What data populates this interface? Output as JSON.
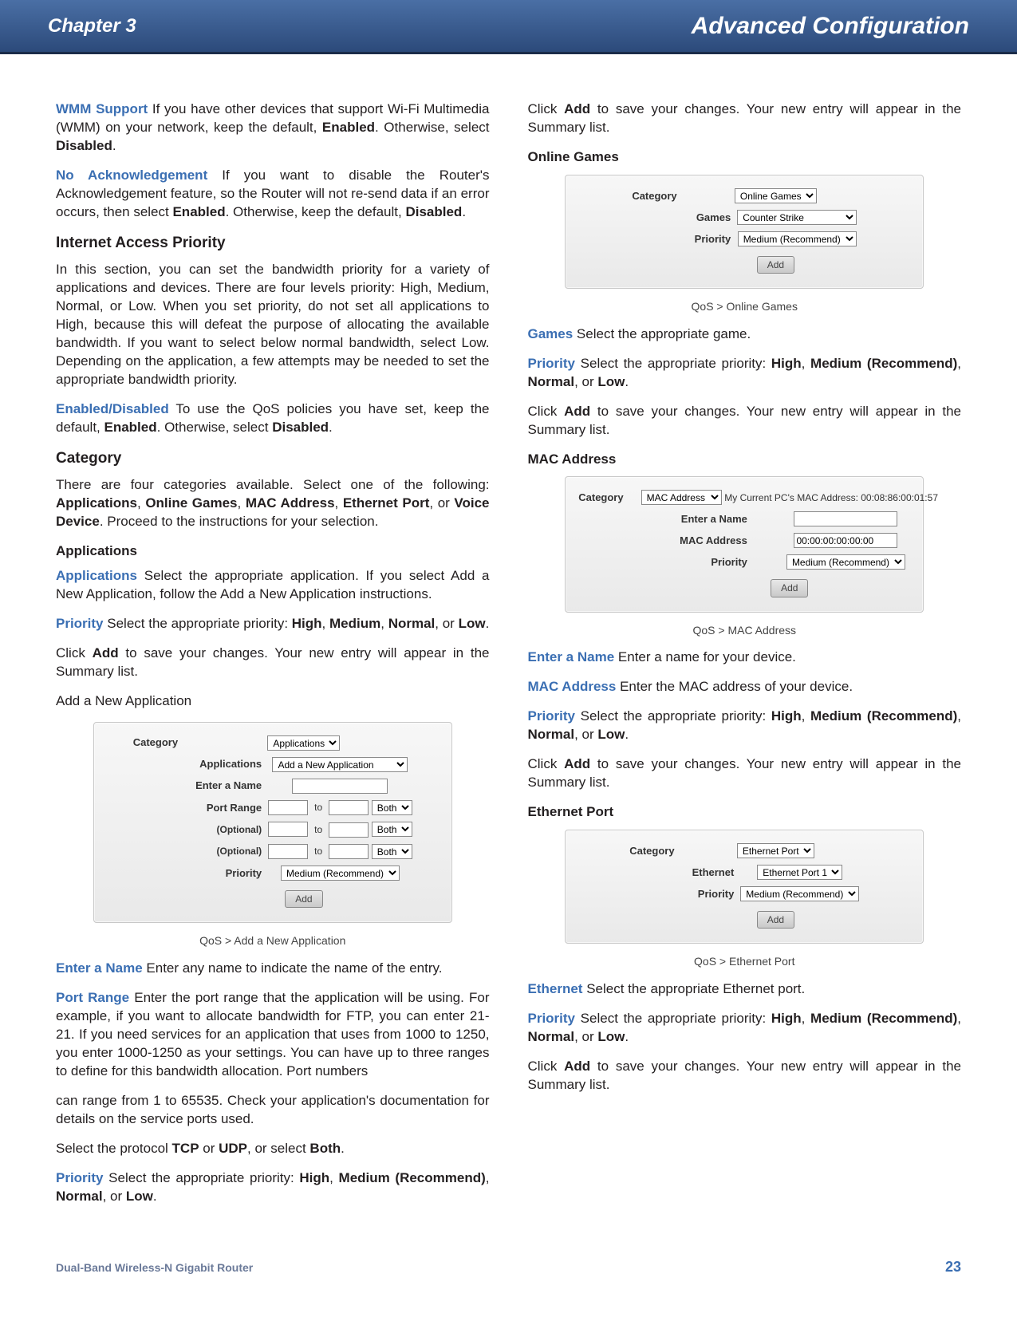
{
  "header": {
    "chapter": "Chapter 3",
    "title": "Advanced Configuration"
  },
  "wmm": {
    "term": "WMM Support",
    "body1": "  If you have other devices that support Wi-Fi Multimedia (WMM) on your network, keep the default, ",
    "enabled": "Enabled",
    "body2": ". Otherwise, select ",
    "disabled": "Disabled",
    "body3": "."
  },
  "noack": {
    "term": "No Acknowledgement",
    "body1": "  If you want to disable the Router's Acknowledgement feature, so the Router will not re-send data if an error occurs, then select ",
    "enabled": "Enabled",
    "body2": ". Otherwise, keep the default, ",
    "disabled": "Disabled",
    "body3": "."
  },
  "iap": {
    "heading": "Internet Access Priority",
    "body": "In this section, you can set the bandwidth priority for a variety of applications and devices. There are four levels priority: High, Medium, Normal, or Low. When you set priority, do not set all applications to High, because this will defeat the purpose of allocating the available bandwidth. If you want to select below normal bandwidth, select Low. Depending on the application, a few attempts may be needed to set the appropriate bandwidth priority."
  },
  "enableddisabled": {
    "term": "Enabled/Disabled",
    "body1": "  To use the QoS policies you have set, keep the default, ",
    "enabled": "Enabled",
    "body2": ". Otherwise, select ",
    "disabled": "Disabled",
    "body3": "."
  },
  "category": {
    "heading": "Category",
    "body1": "There are four categories available. Select one of the following: ",
    "applications": "Applications",
    "sep1": ", ",
    "online": "Online Games",
    "sep2": ", ",
    "mac": "MAC Address",
    "sep3": ", ",
    "eth": "Ethernet Port",
    "sep4": ", or ",
    "voice": "Voice Device",
    "body2": ". Proceed to the instructions for your selection."
  },
  "apps": {
    "heading": "Applications",
    "term": "Applications",
    "body": "  Select the appropriate application. If you select Add a New Application, follow the Add a New Application instructions."
  },
  "priority": {
    "term": "Priority",
    "body1": "  Select the appropriate priority: ",
    "high": "High",
    "sep": ", ",
    "medium": "Medium",
    "sep2": ", ",
    "normal": "Normal",
    "sep3": ", or ",
    "low": "Low",
    "body2": "."
  },
  "priorityRec": {
    "term": "Priority",
    "body1": "  Select the appropriate priority: ",
    "high": "High",
    "sep": ", ",
    "medium": "Medium (Recommend)",
    "sep2": ", ",
    "normal": "Normal",
    "sep3": ", or ",
    "low": "Low",
    "body2": "."
  },
  "clickAdd": {
    "body1": "Click ",
    "add": "Add",
    "body2": " to save your changes. Your new entry will appear in the Summary list."
  },
  "addNewApp": {
    "text": "Add a New Application"
  },
  "fig1": {
    "categoryLbl": "Category",
    "catOpt": "Applications",
    "appsLbl": "Applications",
    "appOpt": "Add a New Application",
    "nameLbl": "Enter a Name",
    "portLbl": "Port Range",
    "optional": "(Optional)",
    "to": "to",
    "both": "Both",
    "prioLbl": "Priority",
    "prioOpt": "Medium (Recommend)",
    "add": "Add",
    "caption": "QoS > Add a New Application"
  },
  "enterName": {
    "term": "Enter a Name",
    "body": "  Enter any name to indicate the name of the entry."
  },
  "portRange": {
    "term": "Port Range",
    "body": "  Enter the port range that the application will be using. For example, if you want to allocate bandwidth for FTP, you can enter 21-21. If you need services for an application that uses from 1000 to 1250, you enter 1000-1250 as your settings. You can have up to three ranges to define for this bandwidth allocation. Port numbers"
  },
  "portRange2": {
    "body": "can range from 1 to 65535. Check your application's documentation for details on the service ports used."
  },
  "protocol": {
    "body1": "Select the protocol ",
    "tcp": "TCP",
    "or1": " or ",
    "udp": "UDP",
    "or2": ", or select ",
    "both": "Both",
    "body2": "."
  },
  "onlineGames": {
    "heading": "Online Games"
  },
  "fig2": {
    "categoryLbl": "Category",
    "catOpt": "Online Games",
    "gamesLbl": "Games",
    "gameOpt": "Counter Strike",
    "prioLbl": "Priority",
    "prioOpt": "Medium (Recommend)",
    "add": "Add",
    "caption": "QoS > Online Games"
  },
  "gamesTerm": {
    "term": "Games",
    "body": "  Select the appropriate game."
  },
  "macAddress": {
    "heading": "MAC Address"
  },
  "fig3": {
    "categoryLbl": "Category",
    "catOpt": "MAC Address",
    "macNote": "My Current PC's MAC Address: 00:08:86:00:01:57",
    "nameLbl": "Enter a Name",
    "macLbl": "MAC Address",
    "macVal": "00:00:00:00:00:00",
    "prioLbl": "Priority",
    "prioOpt": "Medium (Recommend)",
    "add": "Add",
    "caption": "QoS > MAC Address"
  },
  "enterName2": {
    "term": "Enter a Name",
    "body": "  Enter a name for your device."
  },
  "macTerm": {
    "term": "MAC Address",
    "body": "  Enter the MAC address of your device."
  },
  "ethPort": {
    "heading": "Ethernet Port"
  },
  "fig4": {
    "categoryLbl": "Category",
    "catOpt": "Ethernet Port",
    "ethLbl": "Ethernet",
    "ethOpt": "Ethernet Port 1",
    "prioLbl": "Priority",
    "prioOpt": "Medium (Recommend)",
    "add": "Add",
    "caption": "QoS > Ethernet Port"
  },
  "ethTerm": {
    "term": "Ethernet",
    "body": "  Select the appropriate Ethernet port."
  },
  "footer": {
    "product": "Dual-Band Wireless-N Gigabit Router",
    "page": "23"
  }
}
